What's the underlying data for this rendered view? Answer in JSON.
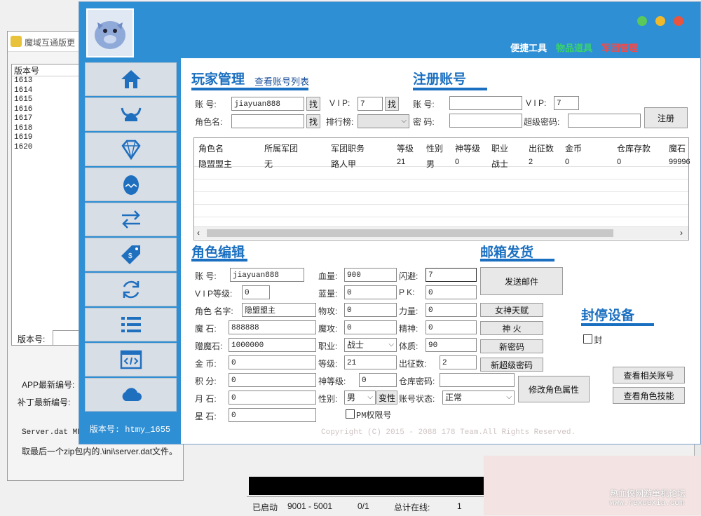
{
  "bg_window": {
    "title": "魔域互通版更",
    "list_header": "版本号",
    "list_items": [
      "1613",
      "1614",
      "1615",
      "1616",
      "1617",
      "1618",
      "1619",
      "1620"
    ],
    "version_label": "版本号:",
    "app_label": "APP最新编号:",
    "patch_label": "补丁最新编号:",
    "server_dat": "Server.dat MD",
    "note": "取最后一个zip包内的.\\ini\\server.dat文件。"
  },
  "main": {
    "top_links": {
      "tools": "便捷工具",
      "items": "物品道具",
      "corps": "军团管理"
    },
    "version": "版本号: htmy_1655",
    "player_mgmt": {
      "title": "玩家管理",
      "view_accounts": "查看账号列表",
      "account_label": "账  号:",
      "account_value": "jiayuan888",
      "find1": "找",
      "vip_label": "V I P:",
      "vip_value": "7",
      "find2": "找",
      "role_label": "角色名:",
      "find3": "找",
      "rank_label": "排行榜:"
    },
    "register": {
      "title": "注册账号",
      "account_label": "账  号:",
      "vip_label": "V I P:",
      "vip_value": "7",
      "password_label": "密  码:",
      "super_label": "超级密码:",
      "register_btn": "注册"
    },
    "table": {
      "headers": [
        "角色名",
        "所属军团",
        "军团职务",
        "等级",
        "性别",
        "神等级",
        "职业",
        "出征数",
        "金币",
        "仓库存款",
        "魔石"
      ],
      "row": [
        "隐盟盟主",
        "无",
        "路人甲",
        "21",
        "男",
        "0",
        "战士",
        "2",
        "0",
        "0",
        "99996"
      ]
    },
    "role_edit": {
      "title": "角色编辑",
      "account_label": "账  号:",
      "account_value": "jiayuan888",
      "vip_label": "V I P等级:",
      "vip_value": "0",
      "name_label": "角色 名字:",
      "name_value": "隐盟盟主",
      "magic_stone_label": "魔  石:",
      "magic_stone_value": "888888",
      "gift_stone_label": "赠魔石:",
      "gift_stone_value": "1000000",
      "gold_label": "金  币:",
      "gold_value": "0",
      "points_label": "积  分:",
      "points_value": "0",
      "moon_label": "月  石:",
      "moon_value": "0",
      "star_label": "星  石:",
      "star_value": "0",
      "hp_label": "血量:",
      "hp_value": "900",
      "mp_label": "蓝量:",
      "mp_value": "0",
      "patk_label": "物攻:",
      "patk_value": "0",
      "matk_label": "魔攻:",
      "matk_value": "0",
      "job_label": "职业:",
      "job_value": "战士",
      "level_label": "等级:",
      "level_value": "21",
      "god_label": "神等级:",
      "god_value": "0",
      "gender_label": "性别:",
      "gender_value": "男",
      "change_gender": "变性",
      "gm_label": "PM权限号",
      "dodge_label": "闪避:",
      "dodge_value": "7",
      "pk_label": "P  K:",
      "pk_value": "0",
      "power_label": "力量:",
      "power_value": "0",
      "spirit_label": "精神:",
      "spirit_value": "0",
      "physique_label": "体质:",
      "physique_value": "90",
      "expedition_label": "出征数:",
      "expedition_value": "2",
      "warehouse_label": "仓库密码:",
      "status_label": "账号状态:",
      "status_value": "正常",
      "btn_talent": "女神天赋",
      "btn_fire": "神  火",
      "btn_newpwd": "新密码",
      "btn_newsuper": "新超级密码",
      "btn_modify": "修改角色属性"
    },
    "mail": {
      "title": "邮箱发货",
      "send_btn": "发送邮件"
    },
    "ban": {
      "title": "封停设备",
      "ban_label": "封",
      "view_accounts": "查看相关账号",
      "view_skills": "查看角色技能"
    },
    "footer": "Copyright (C) 2015 - 2088 178 Team.All Rights Reserved."
  },
  "status_bar": {
    "started": "已启动",
    "ports": "9001 - 5001",
    "count": "0/1",
    "online_label": "总计在线:",
    "online_value": "1"
  },
  "watermark": {
    "line1": "热血侠网游单机论坛",
    "line2": "www.rexuexia.com"
  }
}
